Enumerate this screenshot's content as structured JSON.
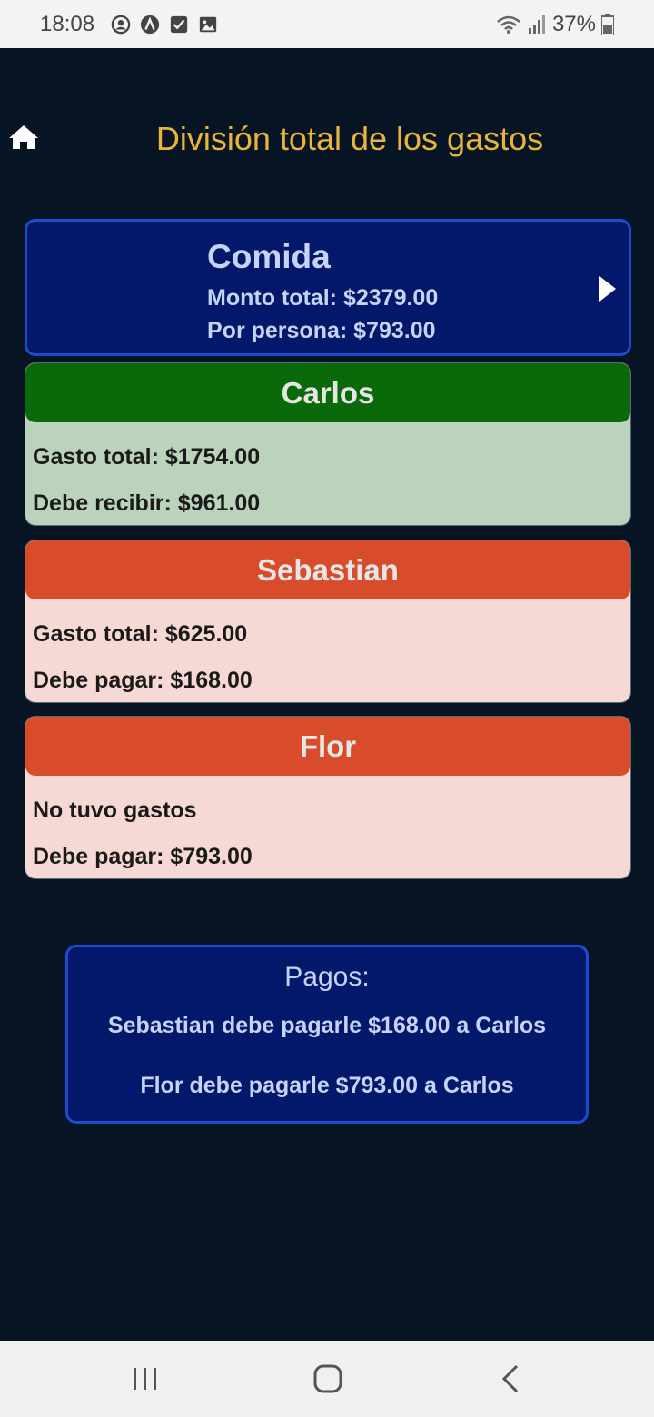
{
  "status_bar": {
    "time": "18:08",
    "battery": "37%",
    "icons": [
      "account-circle-icon",
      "app-a-icon",
      "checkbox-icon",
      "image-icon",
      "wifi-icon",
      "signal-icon",
      "battery-icon"
    ]
  },
  "header": {
    "title": "División total de los gastos",
    "home_icon": "home-icon"
  },
  "category": {
    "name": "Comida",
    "total": "Monto total: $2379.00",
    "per_person": "Por persona: $793.00",
    "chevron_icon": "chevron-right-icon"
  },
  "people": [
    {
      "name": "Carlos",
      "line1": "Gasto total: $1754.00",
      "line2": "Debe recibir: $961.00",
      "status": "receive",
      "color": "#0a6a0a"
    },
    {
      "name": "Sebastian",
      "line1": "Gasto total: $625.00",
      "line2": "Debe pagar: $168.00",
      "status": "pay",
      "color": "#d84c2c"
    },
    {
      "name": "Flor",
      "line1": "No tuvo gastos",
      "line2": "Debe pagar: $793.00",
      "status": "pay",
      "color": "#d84c2c"
    }
  ],
  "payments": {
    "title": "Pagos:",
    "items": [
      "Sebastian debe pagarle $168.00 a Carlos",
      "Flor debe pagarle $793.00 a Carlos"
    ]
  },
  "nav_bar": {
    "icons": [
      "recent-apps-icon",
      "home-circle-icon",
      "back-icon"
    ]
  },
  "colors": {
    "background": "#071423",
    "accent_title": "#e8b53a",
    "card_blue": "#03186b",
    "card_border": "#1f4bd1",
    "green_header": "#0a6a0a",
    "green_body": "#bbd3bd",
    "red_header": "#d84c2c",
    "red_body": "#f6d9d4"
  }
}
